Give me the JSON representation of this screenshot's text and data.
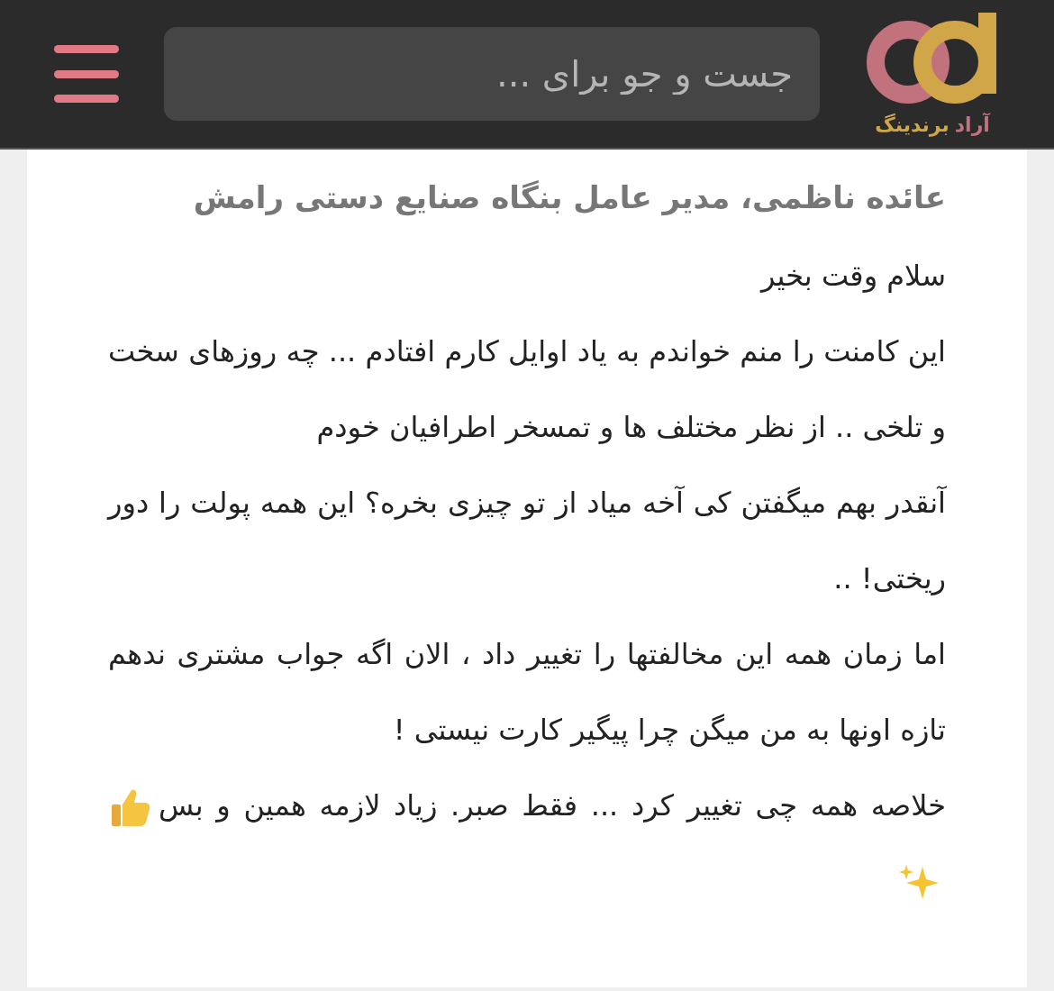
{
  "header": {
    "logo": {
      "word_1": "آراد",
      "word_2": "برندینگ"
    },
    "search": {
      "placeholder": "جست و جو برای ..."
    }
  },
  "article": {
    "heading": "عائده ناظمی، مدیر عامل بنگاه صنایع دستی رامش",
    "paragraphs": [
      {
        "text": "سلام وقت بخیر"
      },
      {
        "text": "این کامنت را منم خواندم به یاد اوایل کارم افتادم ... چه روزهای سخت و تلخی .. از نظر مختلف ها و تمسخر اطرافیان خودم"
      },
      {
        "text": "آنقدر بهم میگفتن کی آخه میاد از تو چیزی بخره؟ این همه پولت را دور ریختی! .."
      },
      {
        "text": "اما زمان همه این مخالفتها را تغییر داد ، الان اگه جواب مشتری ندهم تازه اونها به من میگن چرا پیگیر کارت نیستی !"
      },
      {
        "text": "خلاصه همه چی تغییر کرد ... فقط صبر. زیاد لازمه همین و بس",
        "emoji": true
      }
    ]
  }
}
